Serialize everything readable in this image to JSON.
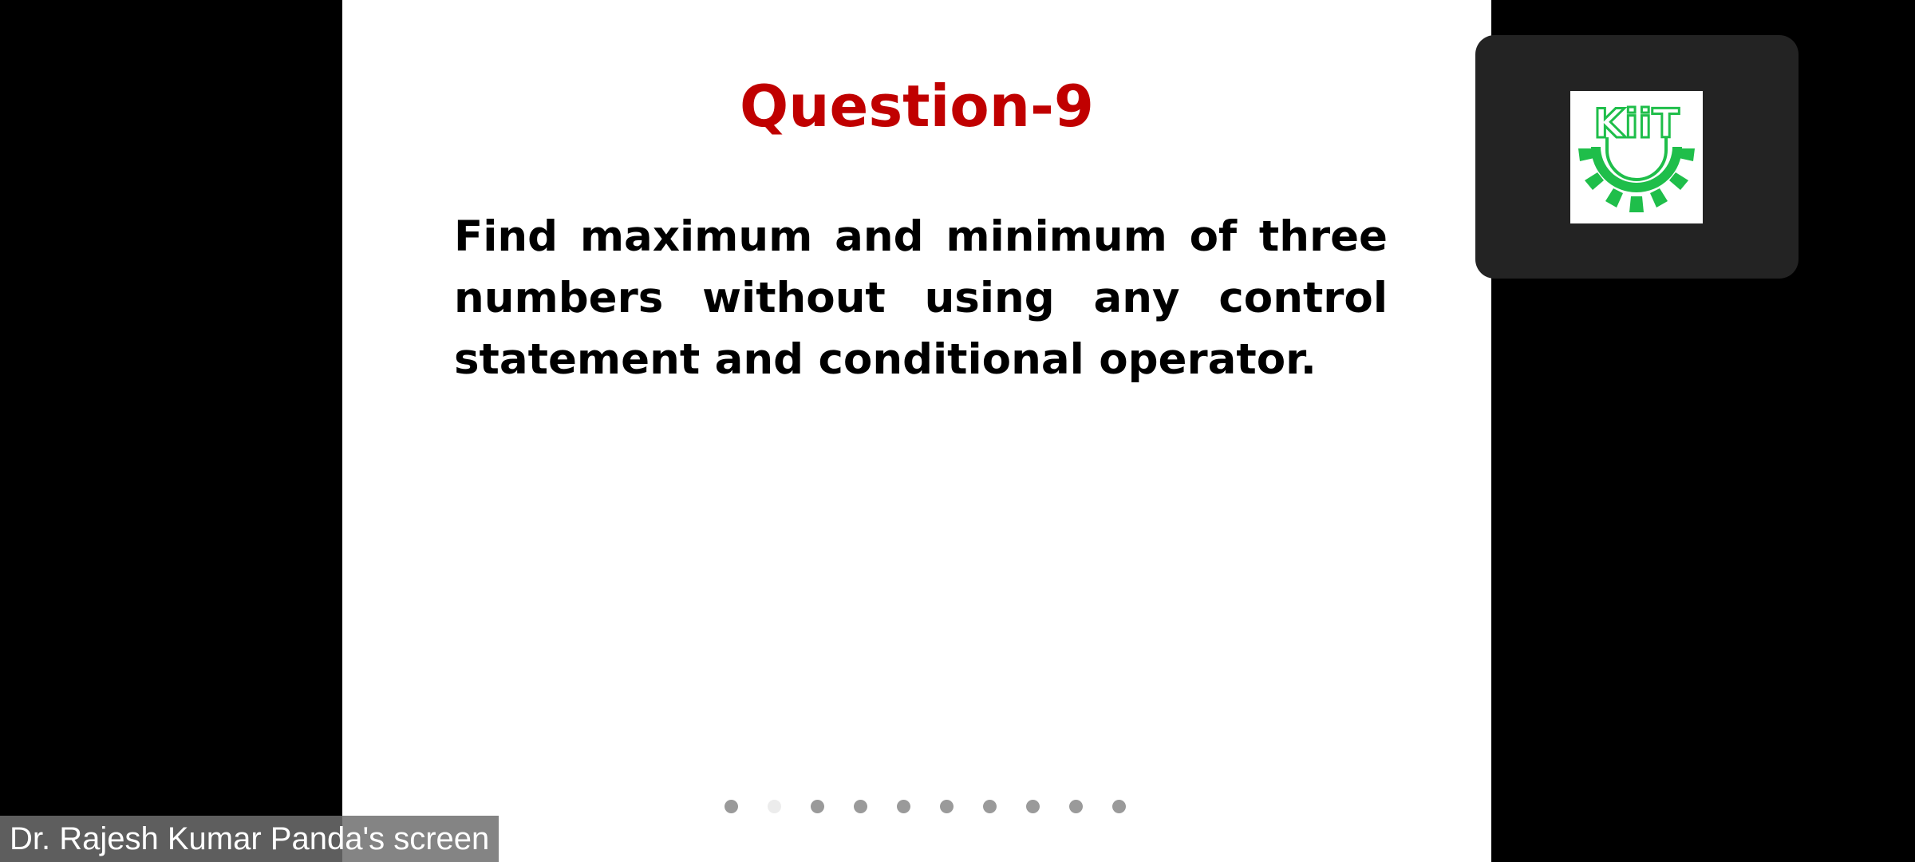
{
  "slide": {
    "title": "Question-9",
    "body": "Find maximum and minimum of three numbers without using any control statement and conditional operator.",
    "title_color": "#c00000",
    "total_slides": 10,
    "current_slide_index": 1
  },
  "participant_tile": {
    "logo_text": "KiiT",
    "logo_color": "#1fbe4a"
  },
  "screen_share": {
    "label": "Dr. Rajesh Kumar Panda's screen"
  }
}
